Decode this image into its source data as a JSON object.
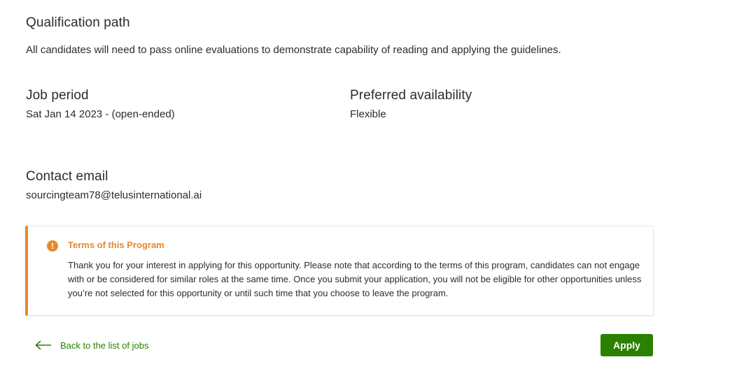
{
  "qualification": {
    "title": "Qualification path",
    "text": "All candidates will need to pass online evaluations to demonstrate capability of reading and applying the guidelines."
  },
  "job_period": {
    "title": "Job period",
    "value": "Sat Jan 14 2023 - (open-ended)"
  },
  "availability": {
    "title": "Preferred availability",
    "value": "Flexible"
  },
  "contact": {
    "title": "Contact email",
    "value": "sourcingteam78@telusinternational.ai"
  },
  "terms": {
    "icon": "warning-icon",
    "icon_glyph": "!",
    "title": "Terms of this Program",
    "body": "Thank you for your interest in applying for this opportunity. Please note that according to the terms of this program, candidates can not engage with or be considered for similar roles at the same time. Once you submit your application, you will not be eligible for other opportunities unless you’re not selected for this opportunity or until such time that you choose to leave the program."
  },
  "footer": {
    "back_icon": "arrow-left-icon",
    "back_label": "Back to the list of jobs",
    "apply_label": "Apply"
  },
  "colors": {
    "accent_green": "#2b8000",
    "warning_orange": "#e8892b",
    "text": "#2a2c2e"
  }
}
